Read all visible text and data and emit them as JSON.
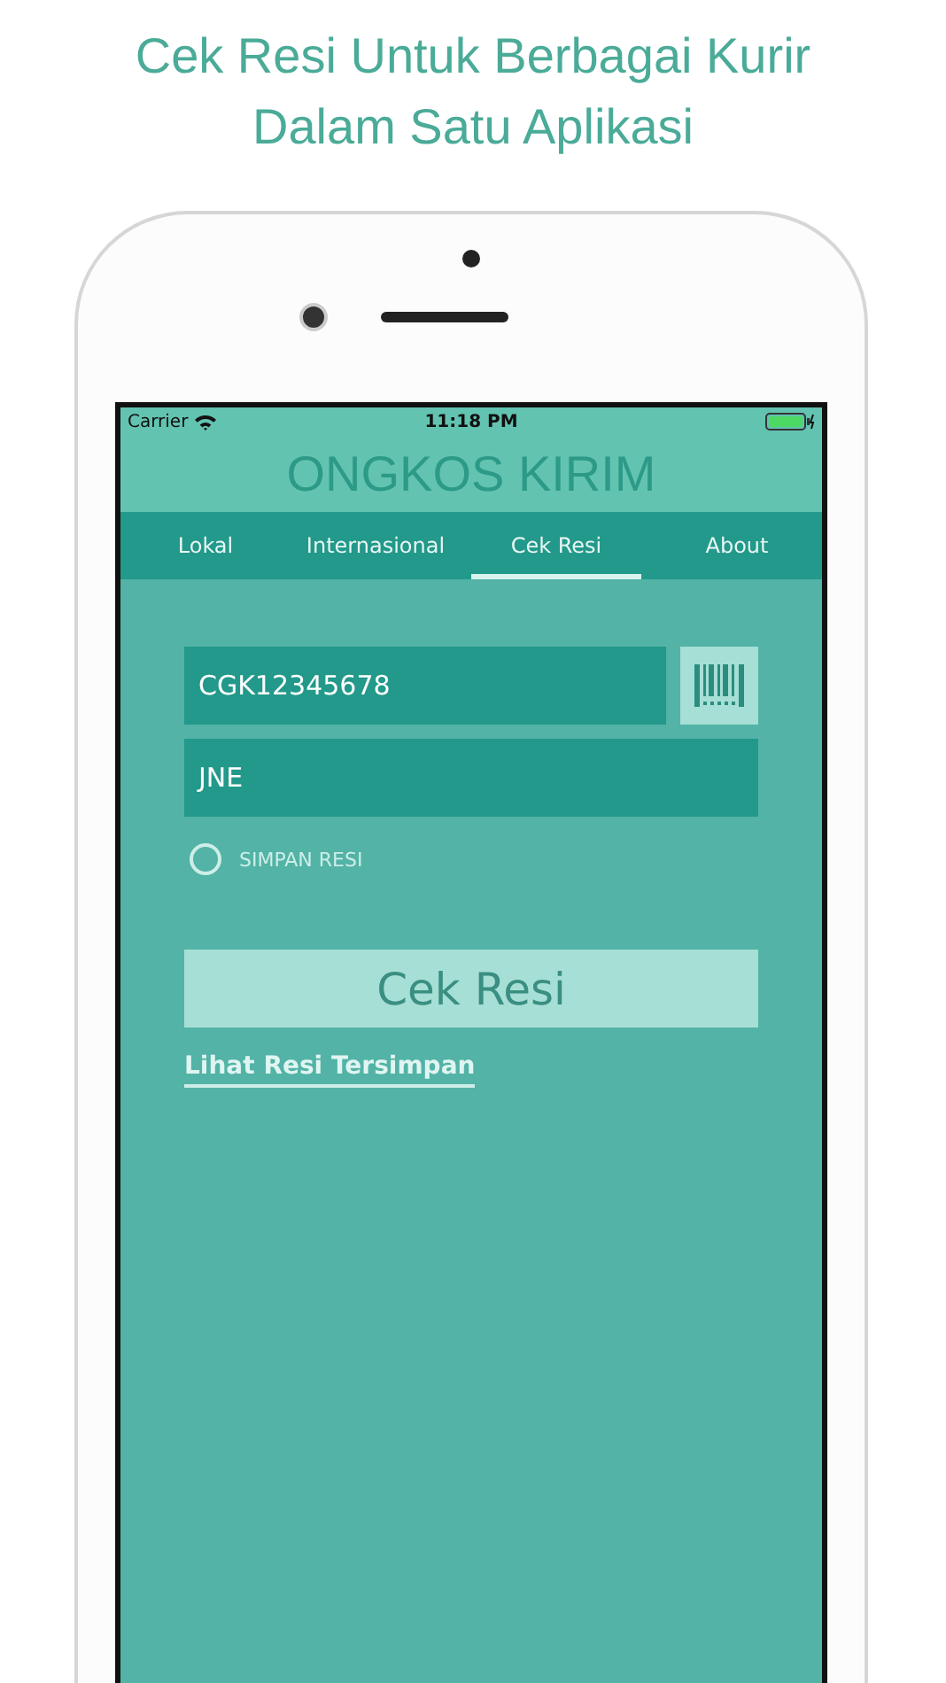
{
  "headline": [
    "Cek Resi Untuk Berbagai Kurir",
    "Dalam Satu Aplikasi"
  ],
  "status_bar": {
    "carrier": "Carrier",
    "time": "11:18 PM"
  },
  "app_title": "ONGKOS KIRIM",
  "tabs": [
    {
      "label": "Lokal",
      "selected": false
    },
    {
      "label": "Internasional",
      "selected": false
    },
    {
      "label": "Cek Resi",
      "selected": true
    },
    {
      "label": "About",
      "selected": false
    }
  ],
  "form": {
    "tracking_number": {
      "value": "CGK12345678"
    },
    "courier": {
      "value": "JNE"
    },
    "save_option": {
      "label": "SIMPAN RESI",
      "checked": false
    },
    "submit": "Cek Resi",
    "saved_link": "Lihat Resi Tersimpan"
  }
}
